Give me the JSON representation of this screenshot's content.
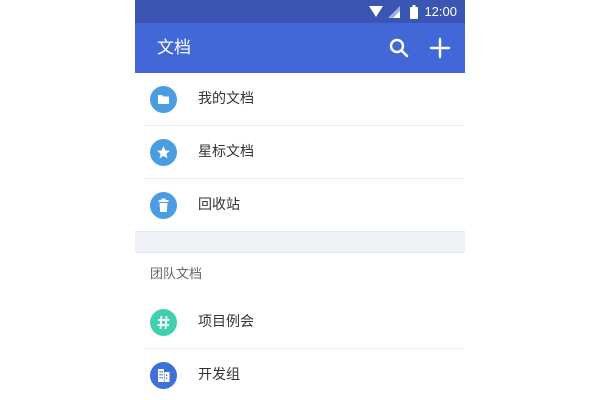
{
  "status_bar": {
    "time": "12:00",
    "icons": [
      "wifi-icon",
      "signal-icon",
      "battery-icon"
    ]
  },
  "app_bar": {
    "title": "文档",
    "actions": [
      "search-icon",
      "add-icon"
    ]
  },
  "main_list": [
    {
      "label": "我的文档",
      "icon": "folder-icon",
      "color": "#4a9de0"
    },
    {
      "label": "星标文档",
      "icon": "star-icon",
      "color": "#4a9de0"
    },
    {
      "label": "回收站",
      "icon": "trash-icon",
      "color": "#4a9de0"
    }
  ],
  "team_section": {
    "header": "团队文档",
    "items": [
      {
        "label": "项目例会",
        "icon": "hashtag-icon",
        "color": "#3fd0b0"
      },
      {
        "label": "开发组",
        "icon": "building-icon",
        "color": "#3f6fd8"
      }
    ]
  },
  "colors": {
    "status_bar": "#3b55b3",
    "app_bar": "#4168d6",
    "section_gap": "#eef1f5"
  }
}
